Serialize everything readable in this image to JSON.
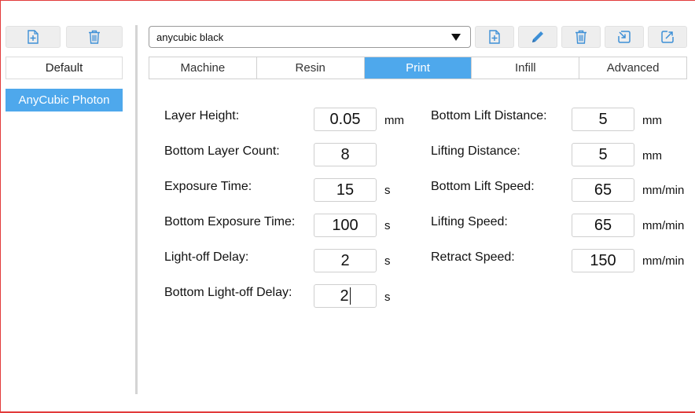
{
  "left_panel": {
    "profiles": [
      {
        "label": "Default",
        "selected": false
      },
      {
        "label": "AnyCubic Photon",
        "selected": true
      }
    ]
  },
  "header": {
    "profile_select_value": "anycubic black"
  },
  "tabs": [
    {
      "label": "Machine",
      "active": false
    },
    {
      "label": "Resin",
      "active": false
    },
    {
      "label": "Print",
      "active": true
    },
    {
      "label": "Infill",
      "active": false
    },
    {
      "label": "Advanced",
      "active": false
    }
  ],
  "fields_left": [
    {
      "label": "Layer Height:",
      "value": "0.05",
      "unit": "mm"
    },
    {
      "label": "Bottom Layer Count:",
      "value": "8",
      "unit": ""
    },
    {
      "label": "Exposure Time:",
      "value": "15",
      "unit": "s"
    },
    {
      "label": "Bottom Exposure Time:",
      "value": "100",
      "unit": "s"
    },
    {
      "label": "Light-off Delay:",
      "value": "2",
      "unit": "s"
    },
    {
      "label": "Bottom Light-off Delay:",
      "value": "2",
      "unit": "s"
    }
  ],
  "fields_right": [
    {
      "label": "Bottom Lift Distance:",
      "value": "5",
      "unit": "mm"
    },
    {
      "label": "Lifting Distance:",
      "value": "5",
      "unit": "mm"
    },
    {
      "label": "Bottom Lift Speed:",
      "value": "65",
      "unit": "mm/min"
    },
    {
      "label": "Lifting Speed:",
      "value": "65",
      "unit": "mm/min"
    },
    {
      "label": "Retract Speed:",
      "value": "150",
      "unit": "mm/min"
    }
  ],
  "colors": {
    "accent": "#4ea8ec",
    "icon_blue": "#3d8fd6",
    "frame_red": "#e23b3b"
  },
  "icons": {
    "left_toolbar": [
      "add-file-icon",
      "trash-icon"
    ],
    "right_toolbar": [
      "add-file-icon",
      "pencil-icon",
      "trash-icon",
      "import-icon",
      "export-icon"
    ]
  }
}
